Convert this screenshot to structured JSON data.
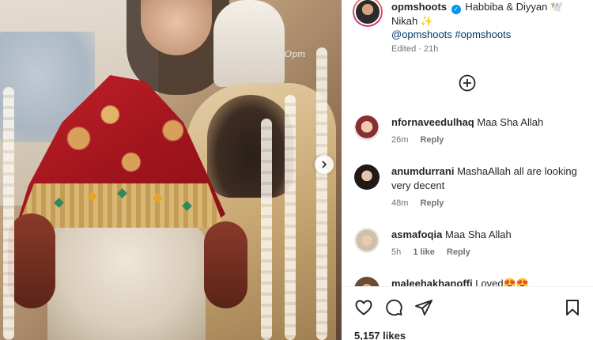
{
  "post": {
    "username": "opmshoots",
    "caption": "Habbiba & Diyyan 🕊️ Nikah ✨",
    "tags": "@opmshoots #opmshoots",
    "edited_label": "Edited",
    "edited_time": "21h",
    "likes": "5,157 likes",
    "photo_watermark": "Opm"
  },
  "comments": [
    {
      "username": "nfornaveedulhaq",
      "text": "Maa Sha Allah",
      "time": "26m",
      "likes": "",
      "reply": "Reply"
    },
    {
      "username": "anumdurrani",
      "text": "MashaAllah all are looking very decent",
      "time": "48m",
      "likes": "",
      "reply": "Reply"
    },
    {
      "username": "asmafoqia",
      "text": "Maa Sha Allah",
      "time": "5h",
      "likes": "1 like",
      "reply": "Reply"
    },
    {
      "username": "maleehakhanoffi",
      "text": "Loved😍😍",
      "time": "",
      "likes": "",
      "reply": ""
    }
  ],
  "icons": {
    "verified": "verified-badge-icon",
    "add": "add-comment-icon",
    "next": "chevron-right-icon",
    "like": "heart-icon",
    "comment": "comment-icon",
    "share": "share-icon",
    "save": "bookmark-icon"
  },
  "colors": {
    "verified": "#0095f6",
    "hashtag": "#00376b",
    "meta": "#737373"
  }
}
